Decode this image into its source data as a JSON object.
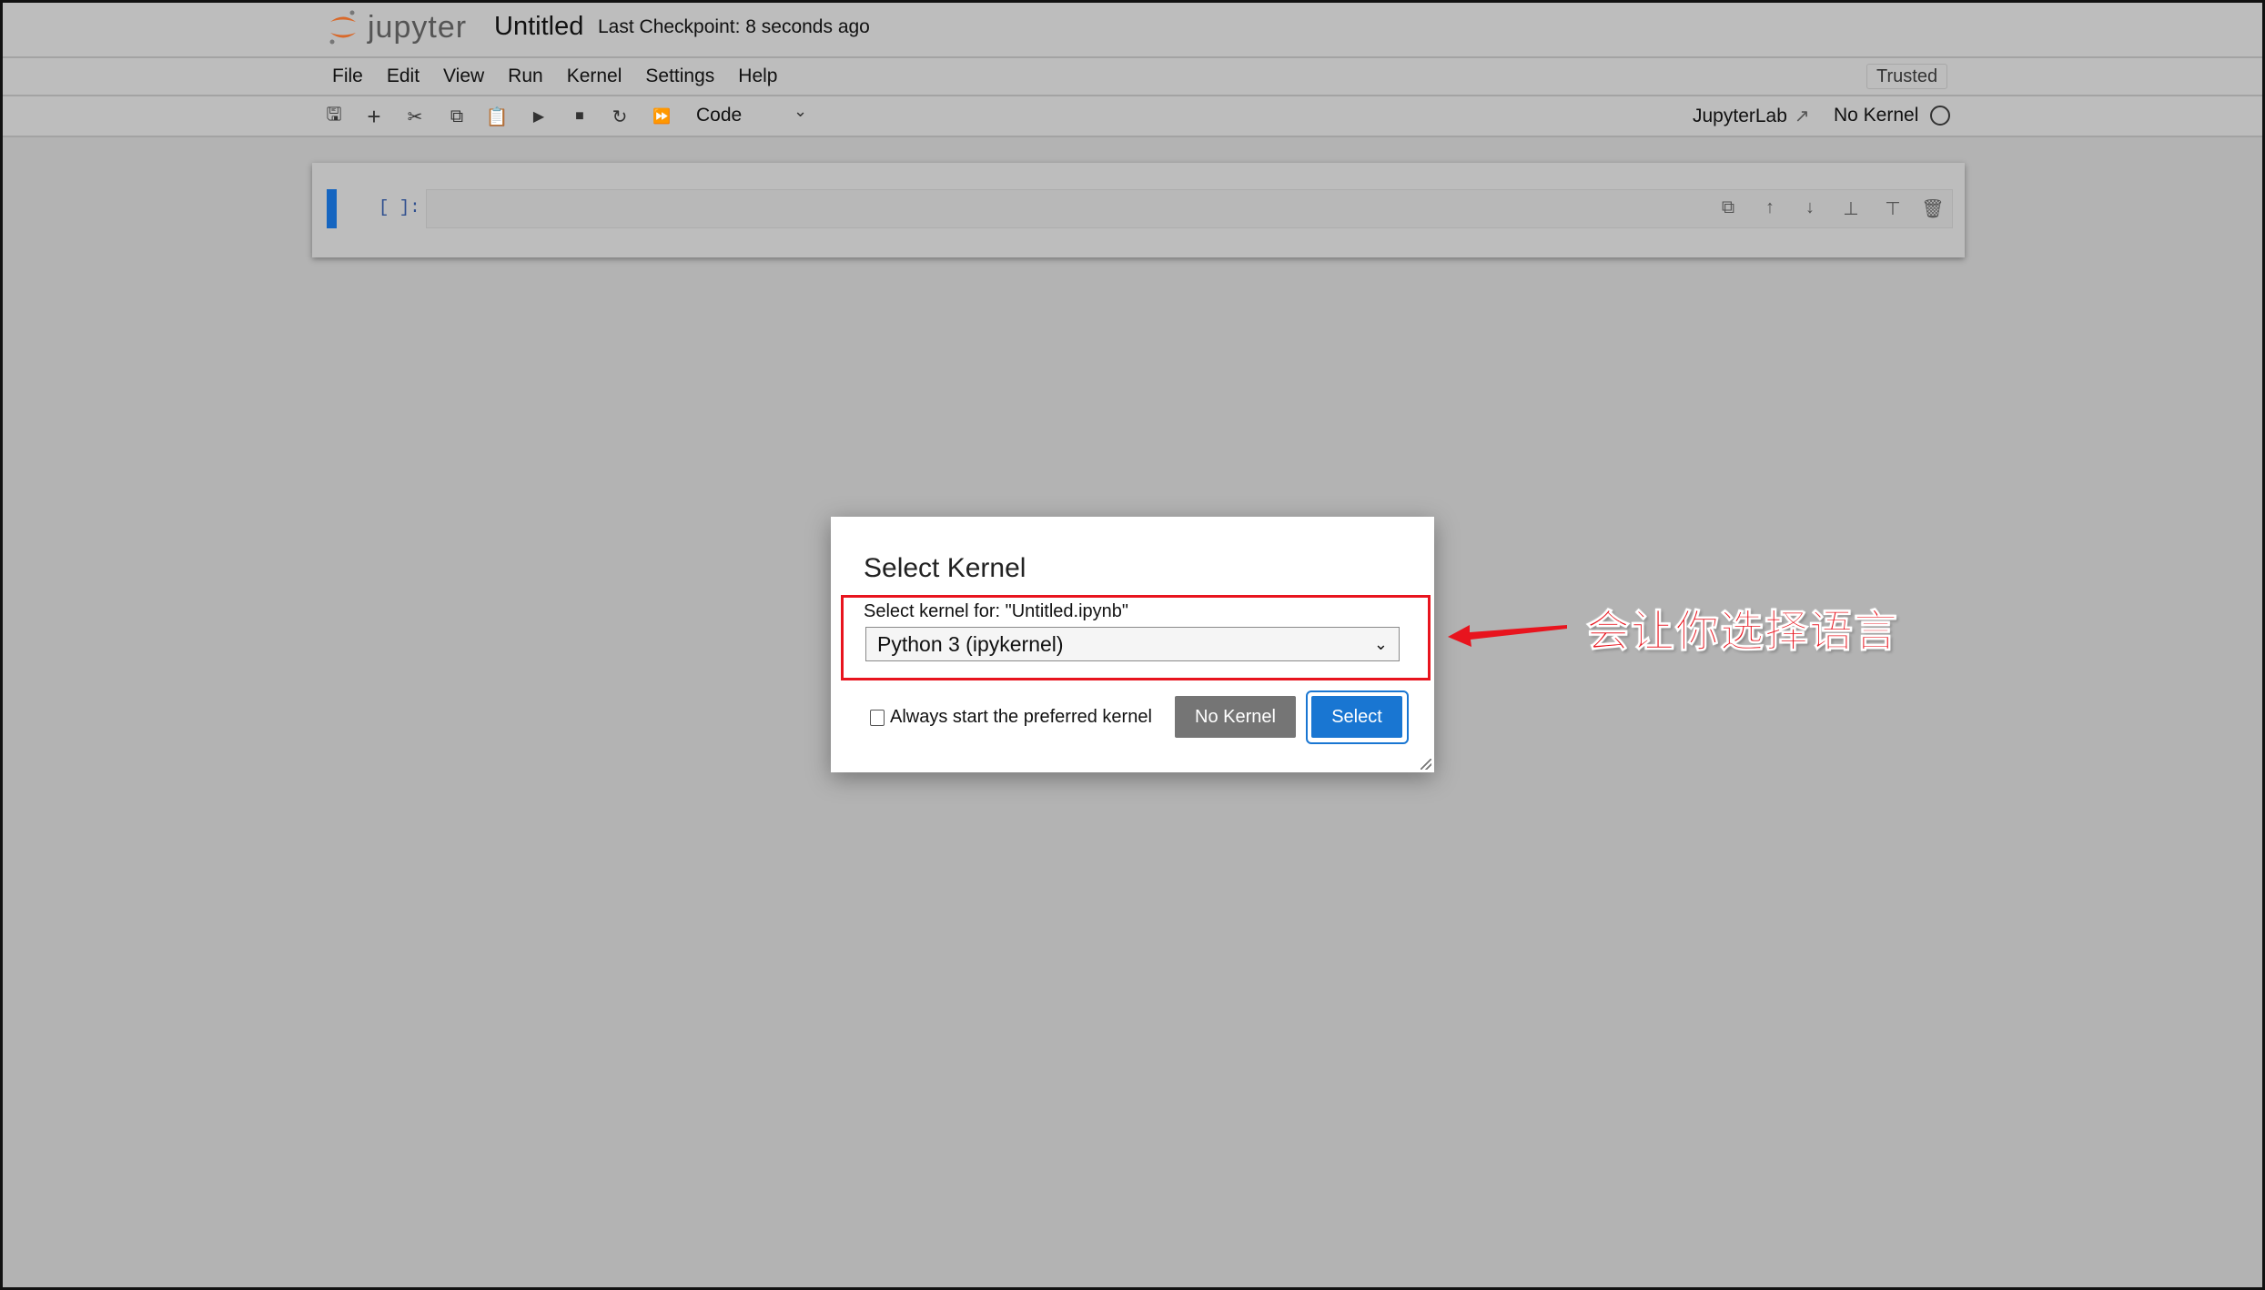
{
  "header": {
    "logo_text": "jupyter",
    "notebook_title": "Untitled",
    "checkpoint": "Last Checkpoint: 8 seconds ago"
  },
  "menu": {
    "items": [
      "File",
      "Edit",
      "View",
      "Run",
      "Kernel",
      "Settings",
      "Help"
    ],
    "trusted": "Trusted"
  },
  "toolbar": {
    "icons": [
      "save-icon",
      "add-icon",
      "cut-icon",
      "copy-icon",
      "paste-icon",
      "run-icon",
      "stop-icon",
      "restart-icon",
      "fast-forward-icon"
    ],
    "cell_type": "Code",
    "jupyterlab_link": "JupyterLab",
    "kernel_status": "No Kernel"
  },
  "cell": {
    "prompt": "[ ]:",
    "value": ""
  },
  "dialog": {
    "title": "Select Kernel",
    "label": "Select kernel for: \"Untitled.ipynb\"",
    "selected_kernel": "Python 3 (ipykernel)",
    "checkbox_label": "Always start the preferred kernel",
    "checkbox_checked": false,
    "no_kernel_button": "No Kernel",
    "select_button": "Select"
  },
  "annotation": {
    "text": "会让你选择语言",
    "color": "#e8141e"
  },
  "colors": {
    "accent": "#1976d2",
    "cell_active": "#1565c0",
    "logo_orange": "#d9692a"
  }
}
